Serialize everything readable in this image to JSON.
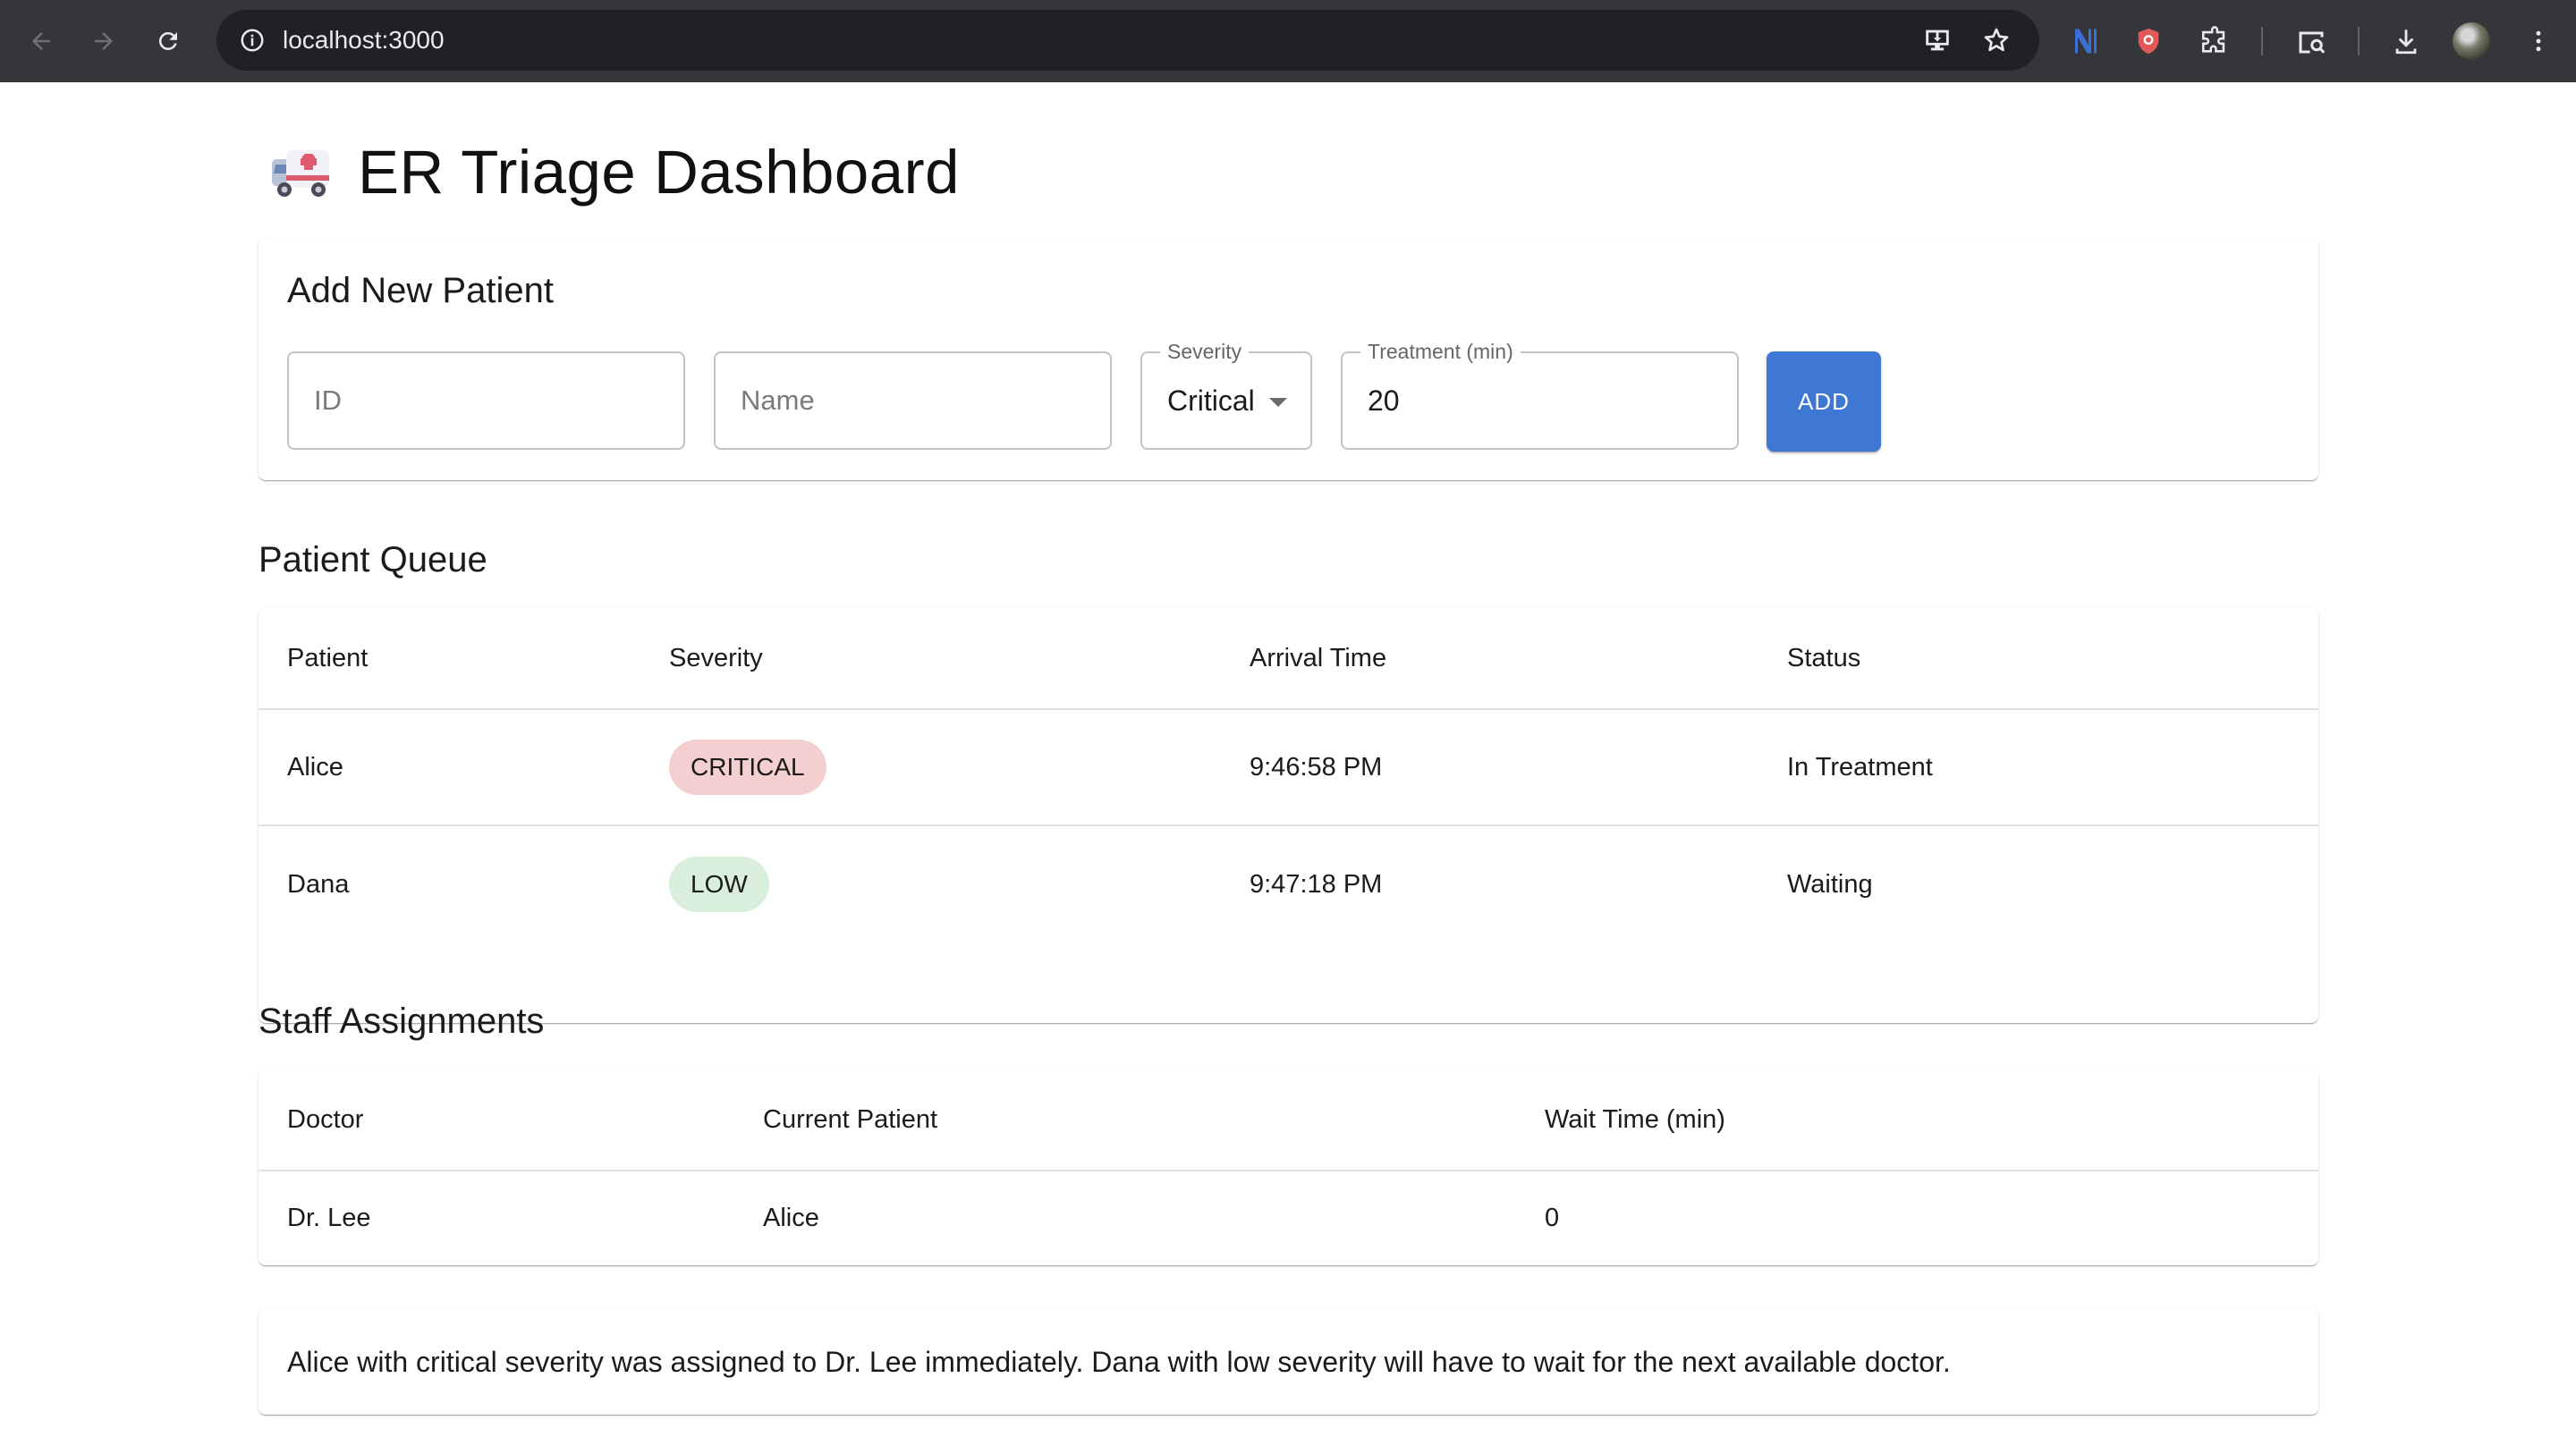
{
  "browser": {
    "url": "localhost:3000"
  },
  "header": {
    "title": "ER Triage Dashboard",
    "icon": "ambulance-icon"
  },
  "add_patient": {
    "title": "Add New Patient",
    "id_placeholder": "ID",
    "name_placeholder": "Name",
    "severity_label": "Severity",
    "severity_value": "Critical",
    "treatment_label": "Treatment (min)",
    "treatment_value": "20",
    "add_label": "ADD"
  },
  "patient_queue": {
    "title": "Patient Queue",
    "columns": [
      "Patient",
      "Severity",
      "Arrival Time",
      "Status"
    ],
    "rows": [
      {
        "patient": "Alice",
        "severity": "CRITICAL",
        "severity_color": "#f4cfcf",
        "arrival": "9:46:58 PM",
        "status": "In Treatment"
      },
      {
        "patient": "Dana",
        "severity": "LOW",
        "severity_color": "#d9eedb",
        "arrival": "9:47:18 PM",
        "status": "Waiting"
      }
    ]
  },
  "staff": {
    "title": "Staff Assignments",
    "columns": [
      "Doctor",
      "Current Patient",
      "Wait Time (min)"
    ],
    "rows": [
      {
        "doctor": "Dr. Lee",
        "patient": "Alice",
        "wait": "0"
      }
    ]
  },
  "summary": {
    "text": "Alice with critical severity was assigned to Dr. Lee immediately. Dana with low severity will have to wait for the next available doctor."
  },
  "colors": {
    "accent": "#3f78d4",
    "critical_chip": "#f4cfcf",
    "low_chip": "#d9eedb"
  }
}
